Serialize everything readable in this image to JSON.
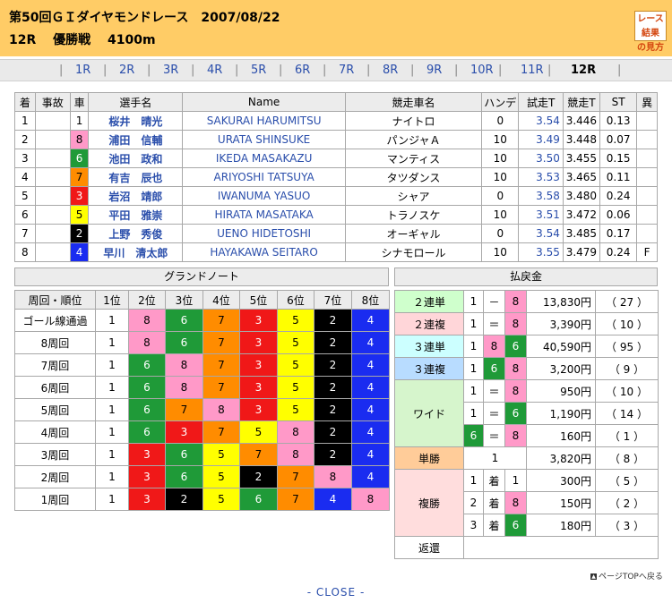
{
  "header": {
    "title": "第50回ＧＩダイヤモンドレース　2007/08/22",
    "race_info": "12R　 優勝戦　 4100m",
    "guide_line1": "レース結果",
    "guide_line2": "の見方"
  },
  "race_tabs": {
    "items": [
      "1R",
      "2R",
      "3R",
      "4R",
      "5R",
      "6R",
      "7R",
      "8R",
      "9R",
      "10R",
      "11R",
      "12R"
    ],
    "current": "12R",
    "separator": "|"
  },
  "results": {
    "headers": [
      "着",
      "事故",
      "車",
      "選手名",
      "Name",
      "競走車名",
      "ハンデ",
      "試走T",
      "競走T",
      "ST",
      "異"
    ],
    "rows": [
      {
        "rank": "1",
        "accident": "",
        "car": "1",
        "rider": "桜井　晴光",
        "name": "SAKURAI HARUMITSU",
        "machine": "ナイトロ",
        "handicap": "0",
        "trial": "3.54",
        "race": "3.446",
        "st": "0.13",
        "ab": ""
      },
      {
        "rank": "2",
        "accident": "",
        "car": "8",
        "rider": "浦田　信輔",
        "name": "URATA SHINSUKE",
        "machine": "パンジャＡ",
        "handicap": "10",
        "trial": "3.49",
        "race": "3.448",
        "st": "0.07",
        "ab": ""
      },
      {
        "rank": "3",
        "accident": "",
        "car": "6",
        "rider": "池田　政和",
        "name": "IKEDA MASAKAZU",
        "machine": "マンティス",
        "handicap": "10",
        "trial": "3.50",
        "race": "3.455",
        "st": "0.15",
        "ab": ""
      },
      {
        "rank": "4",
        "accident": "",
        "car": "7",
        "rider": "有吉　辰也",
        "name": "ARIYOSHI TATSUYA",
        "machine": "タツダンス",
        "handicap": "10",
        "trial": "3.53",
        "race": "3.465",
        "st": "0.11",
        "ab": ""
      },
      {
        "rank": "5",
        "accident": "",
        "car": "3",
        "rider": "岩沼　靖郎",
        "name": "IWANUMA YASUO",
        "machine": "シャア",
        "handicap": "0",
        "trial": "3.58",
        "race": "3.480",
        "st": "0.24",
        "ab": ""
      },
      {
        "rank": "6",
        "accident": "",
        "car": "5",
        "rider": "平田　雅崇",
        "name": "HIRATA MASATAKA",
        "machine": "トラノスケ",
        "handicap": "10",
        "trial": "3.51",
        "race": "3.472",
        "st": "0.06",
        "ab": ""
      },
      {
        "rank": "7",
        "accident": "",
        "car": "2",
        "rider": "上野　秀俊",
        "name": "UENO HIDETOSHI",
        "machine": "オーギャル",
        "handicap": "0",
        "trial": "3.54",
        "race": "3.485",
        "st": "0.17",
        "ab": ""
      },
      {
        "rank": "8",
        "accident": "",
        "car": "4",
        "rider": "早川　清太郎",
        "name": "HAYAKAWA SEITARO",
        "machine": "シナモロール",
        "handicap": "10",
        "trial": "3.55",
        "race": "3.479",
        "st": "0.24",
        "ab": "F"
      }
    ]
  },
  "grand_note": {
    "title": "グランドノート",
    "headers": [
      "周回・順位",
      "1位",
      "2位",
      "3位",
      "4位",
      "5位",
      "6位",
      "7位",
      "8位"
    ],
    "rows": [
      {
        "label": "ゴール線通過",
        "cars": [
          "1",
          "8",
          "6",
          "7",
          "3",
          "5",
          "2",
          "4"
        ]
      },
      {
        "label": "8周回",
        "cars": [
          "1",
          "8",
          "6",
          "7",
          "3",
          "5",
          "2",
          "4"
        ]
      },
      {
        "label": "7周回",
        "cars": [
          "1",
          "6",
          "8",
          "7",
          "3",
          "5",
          "2",
          "4"
        ]
      },
      {
        "label": "6周回",
        "cars": [
          "1",
          "6",
          "8",
          "7",
          "3",
          "5",
          "2",
          "4"
        ]
      },
      {
        "label": "5周回",
        "cars": [
          "1",
          "6",
          "7",
          "8",
          "3",
          "5",
          "2",
          "4"
        ]
      },
      {
        "label": "4周回",
        "cars": [
          "1",
          "6",
          "3",
          "7",
          "5",
          "8",
          "2",
          "4"
        ]
      },
      {
        "label": "3周回",
        "cars": [
          "1",
          "3",
          "6",
          "5",
          "7",
          "8",
          "2",
          "4"
        ]
      },
      {
        "label": "2周回",
        "cars": [
          "1",
          "3",
          "6",
          "5",
          "2",
          "7",
          "8",
          "4"
        ]
      },
      {
        "label": "1周回",
        "cars": [
          "1",
          "3",
          "2",
          "5",
          "6",
          "7",
          "4",
          "8"
        ]
      }
    ]
  },
  "payout": {
    "title": "払戻金",
    "exacta": {
      "label": "２連単",
      "a": "1",
      "sep": "－",
      "b": "8",
      "amount": "13,830円",
      "pop": "（ 27 ）"
    },
    "quinella": {
      "label": "２連複",
      "a": "1",
      "sep": "＝",
      "b": "8",
      "amount": "3,390円",
      "pop": "（ 10 ）"
    },
    "trifecta": {
      "label": "３連単",
      "a": "1",
      "b": "8",
      "c": "6",
      "amount": "40,590円",
      "pop": "（ 95 ）"
    },
    "trio": {
      "label": "３連複",
      "a": "1",
      "b": "6",
      "c": "8",
      "amount": "3,200円",
      "pop": "（ 9 ）"
    },
    "wide": {
      "label": "ワイド",
      "rows": [
        {
          "a": "1",
          "sep": "＝",
          "b": "8",
          "amount": "950円",
          "pop": "（ 10 ）"
        },
        {
          "a": "1",
          "sep": "＝",
          "b": "6",
          "amount": "1,190円",
          "pop": "（ 14 ）"
        },
        {
          "a": "6",
          "sep": "＝",
          "b": "8",
          "amount": "160円",
          "pop": "（ 1 ）"
        }
      ]
    },
    "win": {
      "label": "単勝",
      "car": "1",
      "amount": "3,820円",
      "pop": "（ 8 ）"
    },
    "place": {
      "label": "複勝",
      "rows": [
        {
          "rank": "1",
          "unit": "着",
          "car": "1",
          "amount": "300円",
          "pop": "（ 5 ）"
        },
        {
          "rank": "2",
          "unit": "着",
          "car": "8",
          "amount": "150円",
          "pop": "（ 2 ）"
        },
        {
          "rank": "3",
          "unit": "着",
          "car": "6",
          "amount": "180円",
          "pop": "（ 3 ）"
        }
      ]
    },
    "refund": {
      "label": "返還"
    }
  },
  "footer": {
    "page_top": "ページTOPへ戻る",
    "close": "- CLOSE -"
  },
  "colors": {
    "header_bg": "#ffcc66",
    "car1": "#ffffff",
    "car2": "#000000",
    "car3": "#f01818",
    "car4": "#1a2cf0",
    "car5": "#ffff00",
    "car6": "#1f9a38",
    "car7": "#ff8c00",
    "car8": "#ff99c8",
    "pay_exacta": "#cfffcc",
    "pay_quinella": "#ffd6d9",
    "pay_trifecta": "#ccffff",
    "pay_trio": "#b8dcff",
    "pay_wide": "#d6f5cc",
    "pay_win": "#ffcc99",
    "pay_place": "#ffdddd"
  }
}
